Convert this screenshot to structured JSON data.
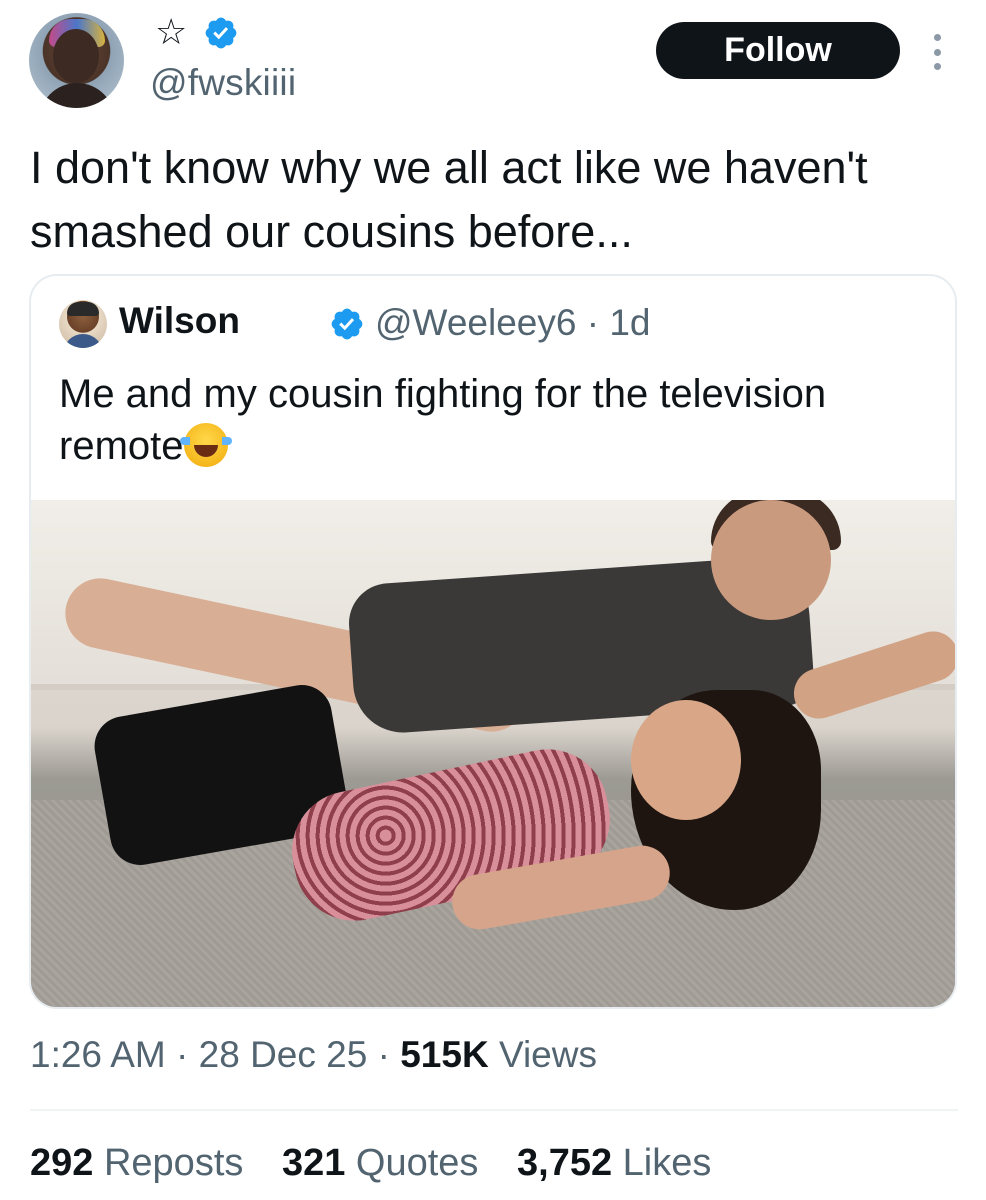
{
  "author": {
    "star": "☆",
    "handle": "@fwskiiii",
    "follow_label": "Follow",
    "accent": "#1d9bf0"
  },
  "tweet": {
    "text": "I don't know why we all act like we haven't smashed our cousins before..."
  },
  "quoted": {
    "name": "Wilson",
    "apple": "",
    "handle": "@Weeleey6",
    "separator": "·",
    "age": "1d",
    "text": "Me and my cousin fighting for the  television remote"
  },
  "meta": {
    "time": "1:26 AM",
    "sep1": "·",
    "date": "28 Dec 25",
    "sep2": "·",
    "views_count": "515K",
    "views_label": "Views"
  },
  "stats": {
    "reposts_count": "292",
    "reposts_label": "Reposts",
    "quotes_count": "321",
    "quotes_label": "Quotes",
    "likes_count": "3,752",
    "likes_label": "Likes"
  }
}
